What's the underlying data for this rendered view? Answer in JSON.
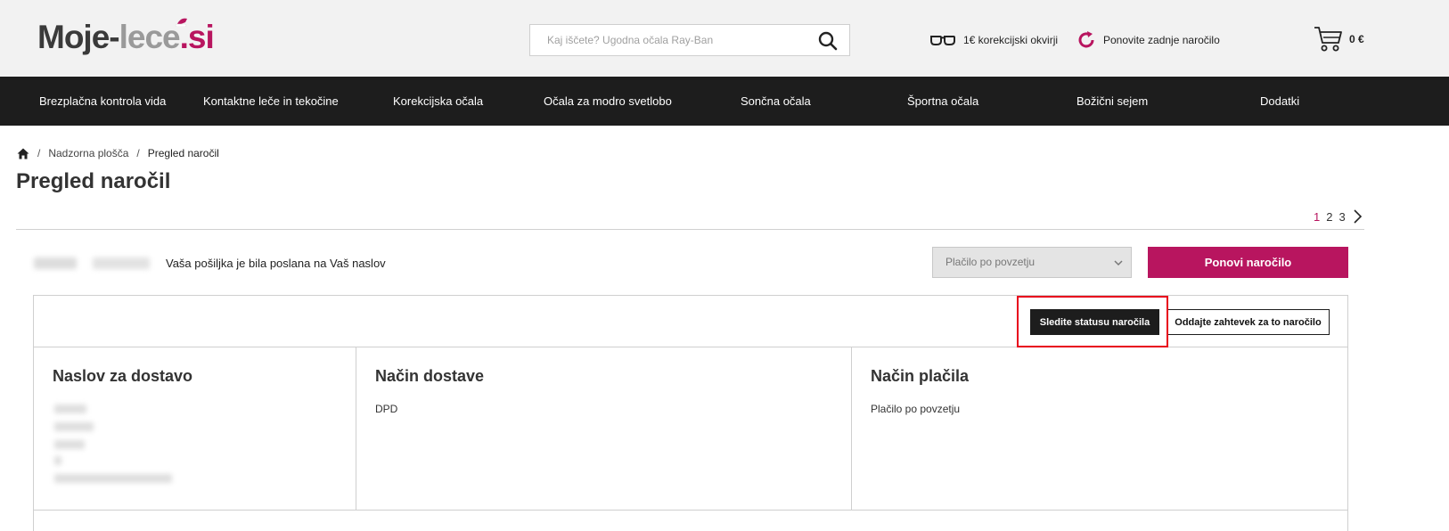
{
  "header": {
    "logo": {
      "part1": "Moje-",
      "part2": "lece",
      "part3": ".si"
    },
    "search": {
      "placeholder": "Kaj iščete? Ugodna očala Ray-Ban",
      "value": ""
    },
    "links": {
      "frames": "1€ korekcijski okvirji",
      "reorder": "Ponovite zadnje naročilo"
    },
    "cart": {
      "amount": "0 €"
    }
  },
  "nav": {
    "items": [
      "Brezplačna kontrola vida",
      "Kontaktne leče in tekočine",
      "Korekcijska očala",
      "Očala za modro svetlobo",
      "Sončna očala",
      "Športna očala",
      "Božični sejem",
      "Dodatki"
    ]
  },
  "breadcrumb": {
    "items": [
      "Nadzorna plošča",
      "Pregled naročil"
    ]
  },
  "page": {
    "title": "Pregled naročil"
  },
  "pagination": {
    "pages": [
      "1",
      "2",
      "3"
    ],
    "current": "1"
  },
  "order": {
    "status_text": "Vaša pošiljka je bila poslana na Vaš naslov",
    "payment_select": {
      "selected": "Plačilo po povzetju"
    },
    "reorder_label": "Ponovi naročilo",
    "track_label": "Sledite statusu naročila",
    "request_label": "Oddajte zahtevek za to naročilo",
    "sections": {
      "shipping_address": {
        "title": "Naslov za dostavo"
      },
      "delivery_method": {
        "title": "Način dostave",
        "value": "DPD"
      },
      "payment_method": {
        "title": "Način plačila",
        "value": "Plačilo po povzetju"
      }
    }
  },
  "colors": {
    "accent": "#b8155f",
    "nav_bg": "#1d1d1d",
    "highlight": "#e8001c"
  }
}
